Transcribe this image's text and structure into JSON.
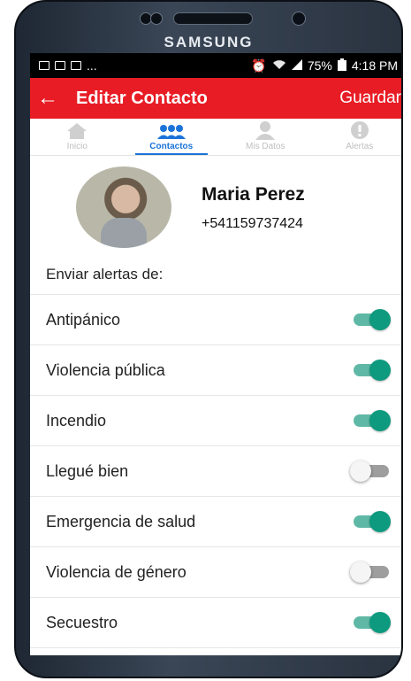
{
  "device": {
    "brand": "SAMSUNG"
  },
  "status_bar": {
    "battery": "75%",
    "time": "4:18 PM",
    "notifications": "..."
  },
  "app_bar": {
    "title": "Editar Contacto",
    "save_label": "Guardar"
  },
  "tabs": [
    {
      "label": "Inicio",
      "icon": "home-icon",
      "active": false
    },
    {
      "label": "Contactos",
      "icon": "contacts-icon",
      "active": true
    },
    {
      "label": "Mis Datos",
      "icon": "person-icon",
      "active": false
    },
    {
      "label": "Alertas",
      "icon": "alert-icon",
      "active": false
    }
  ],
  "contact": {
    "name": "Maria Perez",
    "phone": "+541159737424"
  },
  "alerts_section": {
    "label": "Enviar alertas de:",
    "items": [
      {
        "label": "Antipánico",
        "enabled": true
      },
      {
        "label": "Violencia pública",
        "enabled": true
      },
      {
        "label": "Incendio",
        "enabled": true
      },
      {
        "label": "Llegué bien",
        "enabled": false
      },
      {
        "label": "Emergencia de salud",
        "enabled": true
      },
      {
        "label": "Violencia de género",
        "enabled": false
      },
      {
        "label": "Secuestro",
        "enabled": true
      }
    ]
  },
  "colors": {
    "app_bar": "#e81c24",
    "active_tab": "#1a73d9",
    "switch_on": "#0d9a7e"
  }
}
